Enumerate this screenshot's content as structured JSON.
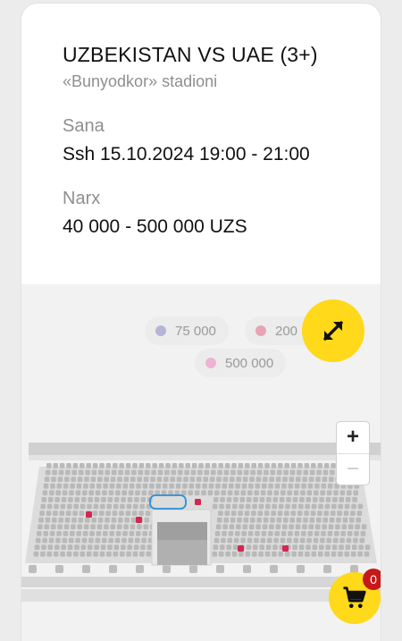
{
  "event": {
    "title": "UZBEKISTAN VS UAE (3+)",
    "venue": "«Bunyodkor» stadioni",
    "date_label": "Sana",
    "date_value": "Ssh 15.10.2024 19:00 - 21:00",
    "price_label": "Narx",
    "price_value": "40 000 - 500 000 UZS"
  },
  "legend": [
    {
      "label": "75 000",
      "color": "#b5b5d6"
    },
    {
      "label": "200",
      "color": "#e9a3b5"
    },
    {
      "label": "500 000",
      "color": "#eeb3d4"
    }
  ],
  "zoom": {
    "in": "+",
    "out": "−"
  },
  "cart": {
    "count": "0"
  },
  "colors": {
    "accent": "#ffd91a",
    "badge": "#c51818",
    "selected_seat": "#d2284f",
    "seat": "#b9b9b9",
    "selection_outline": "#2b8fd6"
  },
  "icons": [
    "expand-icon",
    "cart-icon",
    "plus-icon",
    "minus-icon"
  ]
}
